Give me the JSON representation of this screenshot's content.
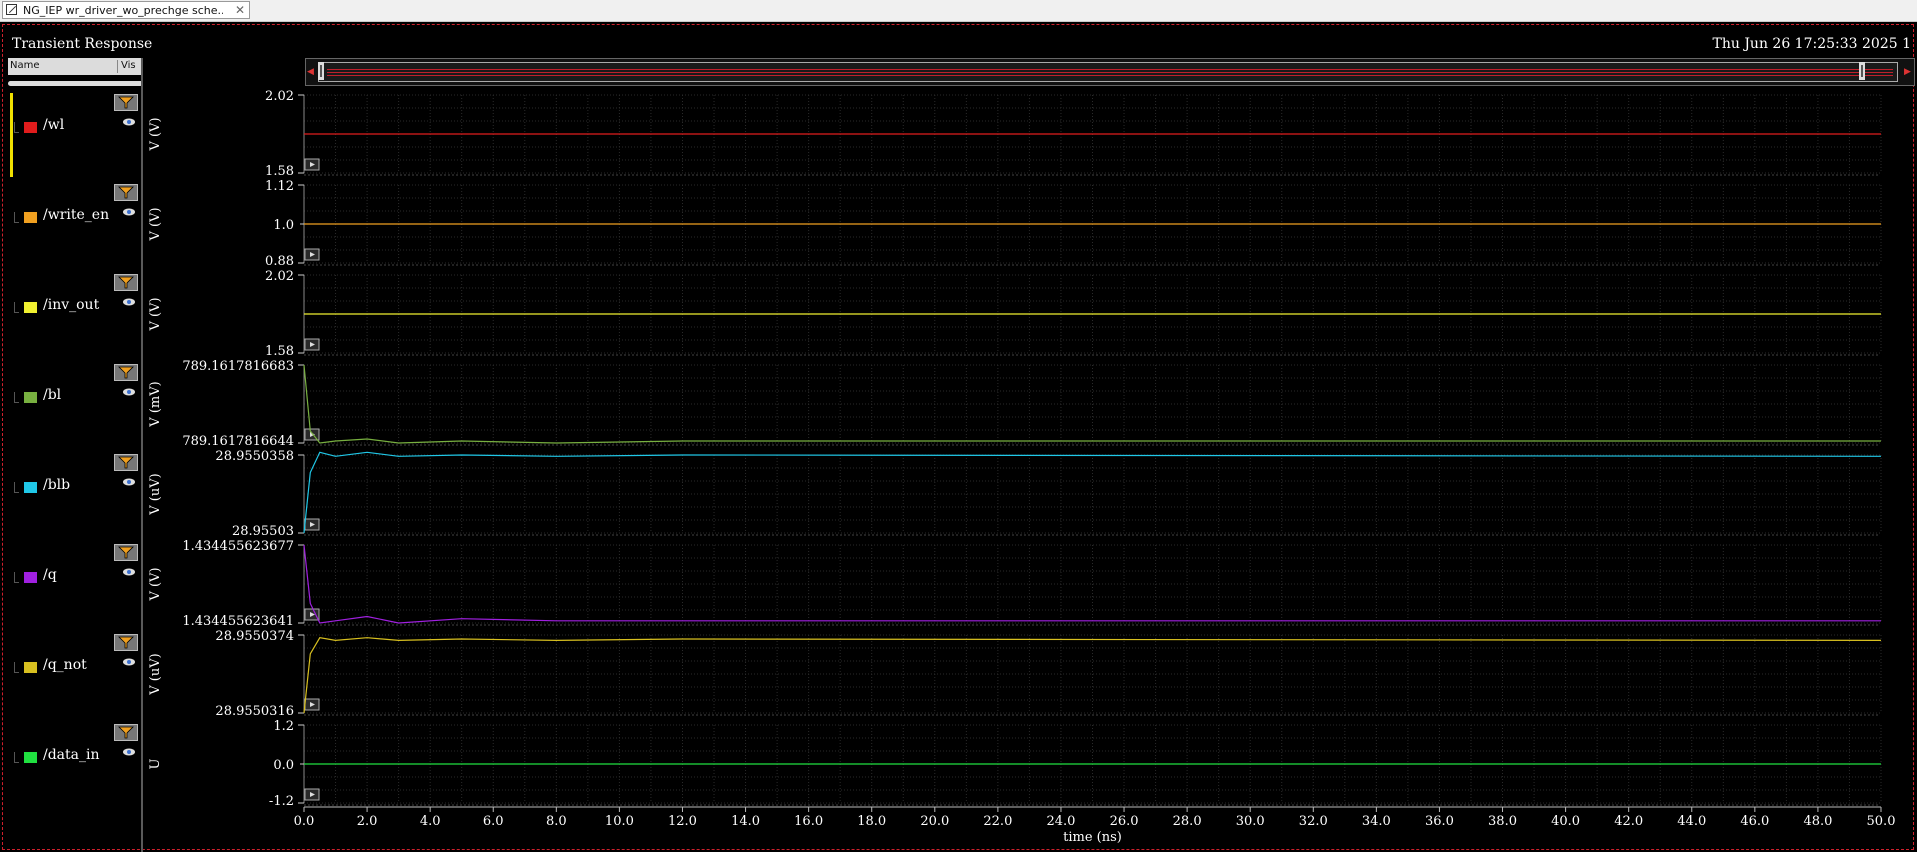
{
  "tab": {
    "title": "NG_IEP wr_driver_wo_prechge sche...",
    "close": "✕"
  },
  "header": {
    "title": "Transient Response",
    "datetime": "Thu Jun 26 17:25:33 2025  1"
  },
  "sidebar": {
    "col_name": "Name",
    "col_vis": "Vis"
  },
  "xaxis": {
    "label": "time (ns)",
    "ticks": [
      "0.0",
      "2.0",
      "4.0",
      "6.0",
      "8.0",
      "10.0",
      "12.0",
      "14.0",
      "16.0",
      "18.0",
      "20.0",
      "22.0",
      "24.0",
      "26.0",
      "28.0",
      "30.0",
      "32.0",
      "34.0",
      "36.0",
      "38.0",
      "40.0",
      "42.0",
      "44.0",
      "46.0",
      "48.0",
      "50.0"
    ]
  },
  "colors": {
    "background": "#000000",
    "grid": "#2a2a2a",
    "accent_border": "#d0202c"
  },
  "signals": [
    {
      "name": "/wl",
      "color": "#e01c1c",
      "unit": "V (V)",
      "ytop": "2.02",
      "ymid": "",
      "ybot": "1.58",
      "icon": "filter-icon"
    },
    {
      "name": "/write_en",
      "color": "#f0a020",
      "unit": "V (V)",
      "ytop": "1.12",
      "ymid": "1.0",
      "ybot": "0.88",
      "icon": "filter-icon"
    },
    {
      "name": "/inv_out",
      "color": "#f0f030",
      "unit": "V (V)",
      "ytop": "2.02",
      "ymid": "",
      "ybot": "1.58",
      "icon": "filter-icon"
    },
    {
      "name": "/bl",
      "color": "#78b040",
      "unit": "V (mV)",
      "ytop": "789.1617816683",
      "ymid": "",
      "ybot": "789.1617816644",
      "icon": "filter-icon"
    },
    {
      "name": "/blb",
      "color": "#20c8e8",
      "unit": "V (uV)",
      "ytop": "28.9550358",
      "ymid": "",
      "ybot": "28.95503",
      "icon": "filter-icon"
    },
    {
      "name": "/q",
      "color": "#a020e0",
      "unit": "V (V)",
      "ytop": "1.434455623677",
      "ymid": "",
      "ybot": "1.434455623641",
      "icon": "filter-icon"
    },
    {
      "name": "/q_not",
      "color": "#d8c020",
      "unit": "V (uV)",
      "ytop": "28.9550374",
      "ymid": "",
      "ybot": "28.9550316",
      "icon": "filter-icon"
    },
    {
      "name": "/data_in",
      "color": "#20e040",
      "unit": "U",
      "ytop": "1.2",
      "ymid": "0.0",
      "ybot": "-1.2",
      "icon": "filter-icon"
    }
  ],
  "chart_data": {
    "type": "line",
    "title": "Transient Response",
    "xlabel": "time (ns)",
    "xlim": [
      0,
      50
    ],
    "grid": true,
    "legend": "left",
    "series": [
      {
        "name": "/wl",
        "ylabel": "V (V)",
        "ylim": [
          1.58,
          2.02
        ],
        "x": [
          0,
          50
        ],
        "y": [
          1.8,
          1.8
        ]
      },
      {
        "name": "/write_en",
        "ylabel": "V (V)",
        "ylim": [
          0.88,
          1.12
        ],
        "x": [
          0,
          50
        ],
        "y": [
          1.0,
          1.0
        ]
      },
      {
        "name": "/inv_out",
        "ylabel": "V (V)",
        "ylim": [
          1.58,
          2.02
        ],
        "x": [
          0,
          50
        ],
        "y": [
          1.8,
          1.8
        ]
      },
      {
        "name": "/bl",
        "ylabel": "V (mV)",
        "ylim": [
          789.1617816644,
          789.1617816683
        ],
        "x": [
          0,
          0.2,
          0.5,
          1.0,
          2.0,
          3.0,
          5.0,
          8.0,
          12.0,
          50
        ],
        "y": [
          789.1617816683,
          789.161781665,
          789.1617816644,
          789.1617816645,
          789.1617816646,
          789.1617816644,
          789.1617816645,
          789.1617816644,
          789.1617816645,
          789.1617816645
        ]
      },
      {
        "name": "/blb",
        "ylabel": "V (uV)",
        "ylim": [
          28.95503,
          28.9550358
        ],
        "x": [
          0,
          0.2,
          0.5,
          1.0,
          2.0,
          3.0,
          5.0,
          8.0,
          12.0,
          50
        ],
        "y": [
          28.95503,
          28.9550345,
          28.955036,
          28.9550357,
          28.955036,
          28.9550357,
          28.9550358,
          28.9550357,
          28.9550358,
          28.9550357
        ]
      },
      {
        "name": "/q",
        "ylabel": "V (V)",
        "ylim": [
          1.434455623641,
          1.434455623677
        ],
        "x": [
          0,
          0.2,
          0.5,
          1.0,
          2.0,
          3.0,
          5.0,
          8.0,
          12.0,
          50
        ],
        "y": [
          1.434455623677,
          1.43445562365,
          1.434455623641,
          1.434455623642,
          1.434455623644,
          1.434455623641,
          1.434455623643,
          1.434455623642,
          1.434455623642,
          1.434455623642
        ]
      },
      {
        "name": "/q_not",
        "ylabel": "V (uV)",
        "ylim": [
          28.9550316,
          28.9550374
        ],
        "x": [
          0,
          0.2,
          0.5,
          1.0,
          2.0,
          3.0,
          5.0,
          8.0,
          12.0,
          50
        ],
        "y": [
          28.9550316,
          28.955036,
          28.9550372,
          28.955037,
          28.9550372,
          28.955037,
          28.9550371,
          28.955037,
          28.9550371,
          28.955037
        ]
      },
      {
        "name": "/data_in",
        "ylabel": "U",
        "ylim": [
          -1.2,
          1.2
        ],
        "x": [
          0,
          50
        ],
        "y": [
          0,
          0
        ]
      }
    ]
  }
}
